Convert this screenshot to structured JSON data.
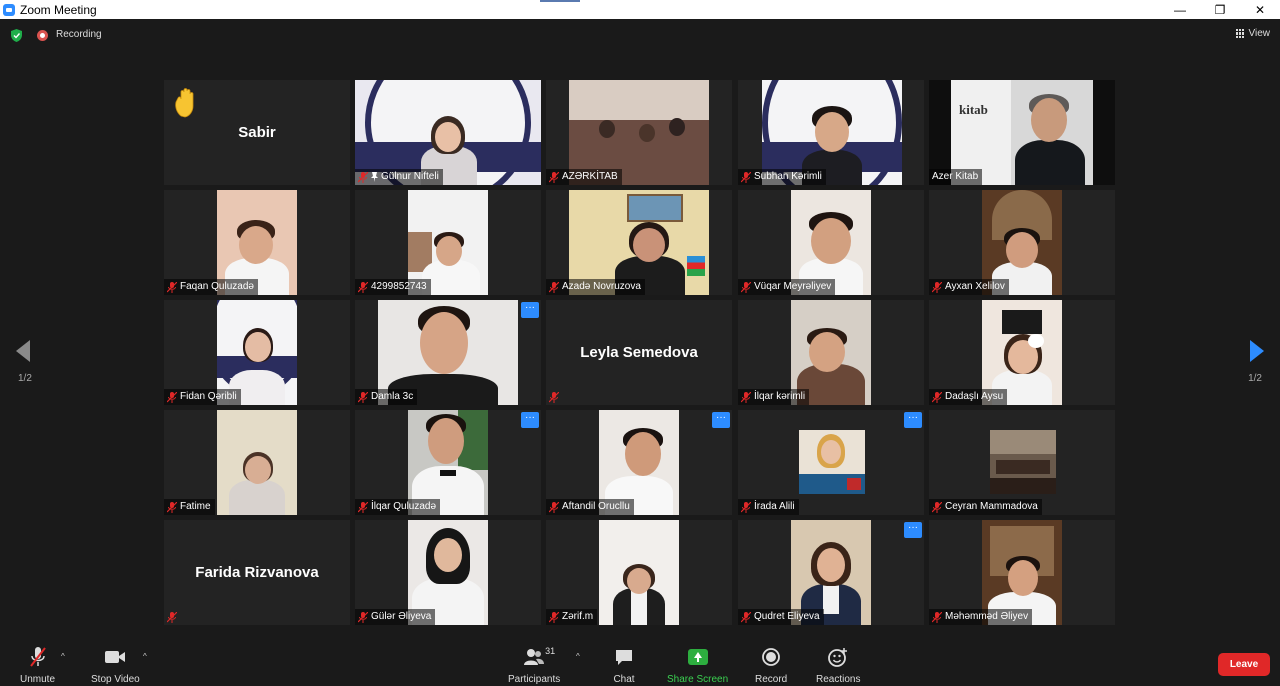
{
  "window": {
    "title": "Zoom Meeting",
    "minimize": "—",
    "maximize": "❐",
    "close": "✕"
  },
  "infobar": {
    "recording_label": "Recording",
    "view_label": "View"
  },
  "pagination": {
    "left": "1/2",
    "right": "1/2"
  },
  "participants": [
    {
      "id": "sabir",
      "name": "Sabir",
      "display_text": "Sabir",
      "raised_hand": true,
      "muted": false
    },
    {
      "id": "gulnur",
      "name": "Gülnur Nifteli",
      "muted": true,
      "pinned": true
    },
    {
      "id": "azerkitab",
      "name": "AZƏRKİTAB",
      "muted": true
    },
    {
      "id": "subhan",
      "name": "Subhan Kərimli",
      "muted": true
    },
    {
      "id": "azer",
      "name": "Azer Kitab",
      "muted": false,
      "active_speaker": true
    },
    {
      "id": "faqan",
      "name": "Faqan Quluzadə",
      "muted": true
    },
    {
      "id": "phone",
      "name": "4299852743",
      "muted": true
    },
    {
      "id": "azada",
      "name": "Azadə Novruzova",
      "muted": true
    },
    {
      "id": "vuqar",
      "name": "Vüqar Meyrəliyev",
      "muted": true
    },
    {
      "id": "ayxan",
      "name": "Ayxan Xelilov",
      "muted": true
    },
    {
      "id": "fidan",
      "name": "Fidan Qəribli",
      "muted": true
    },
    {
      "id": "damla",
      "name": "Damla 3c",
      "muted": true,
      "more_button": true
    },
    {
      "id": "leyla",
      "name": "",
      "display_text": "Leyla Semedova",
      "muted": true
    },
    {
      "id": "ilqar_k",
      "name": "İlqar kərimli",
      "muted": true
    },
    {
      "id": "aysu",
      "name": "Dadaşlı Aysu",
      "muted": true
    },
    {
      "id": "fatime",
      "name": "Fatime",
      "muted": true
    },
    {
      "id": "ilqar_q",
      "name": "İlqar Quluzadə",
      "muted": true,
      "more_button": true
    },
    {
      "id": "aftandil",
      "name": "Aftandil Orucllu",
      "muted": true,
      "more_button": true
    },
    {
      "id": "irada",
      "name": "İrada Alili",
      "muted": true,
      "more_button": true
    },
    {
      "id": "ceyran",
      "name": "Ceyran Mammadova",
      "muted": true
    },
    {
      "id": "farida",
      "name": "",
      "display_text": "Farida Rizvanova",
      "muted": true
    },
    {
      "id": "guler",
      "name": "Gülər Əliyeva",
      "muted": true
    },
    {
      "id": "zerif",
      "name": "Zərif.m",
      "muted": true
    },
    {
      "id": "qudret",
      "name": "Qudret Eliyeva",
      "muted": true,
      "more_button": true
    },
    {
      "id": "memmed",
      "name": "Məhəmməd Əliyev",
      "muted": true
    }
  ],
  "toolbar": {
    "unmute": "Unmute",
    "stop_video": "Stop Video",
    "participants": "Participants",
    "participant_count": "31",
    "chat": "Chat",
    "share_screen": "Share Screen",
    "record": "Record",
    "reactions": "Reactions",
    "leave": "Leave",
    "caret": "^"
  },
  "colors": {
    "accent": "#2d8cff",
    "leave": "#e02828",
    "share": "#2dae3f",
    "active_speaker": "#d9e265",
    "mic_off": "#e02828"
  }
}
